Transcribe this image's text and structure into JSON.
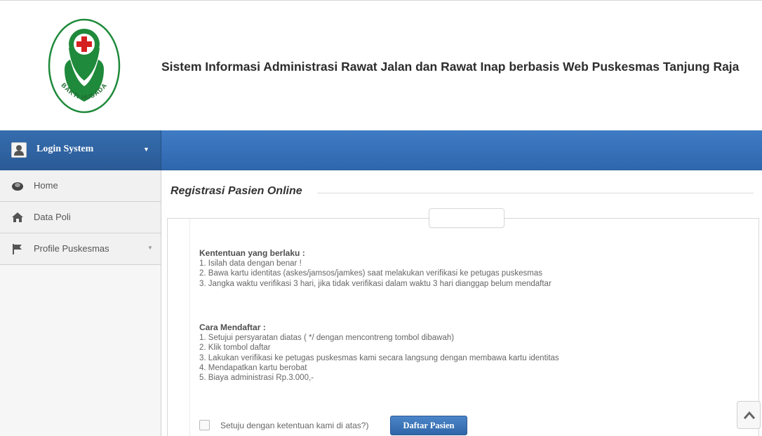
{
  "header": {
    "logo_text": "BAKTI HUSADA",
    "title": "Sistem Informasi Administrasi Rawat Jalan dan Rawat Inap berbasis Web Puskesmas Tanjung Raja"
  },
  "topbar": {
    "login_label": "Login System",
    "login_icon": "user-icon",
    "caret_icon": "caret-down-icon"
  },
  "sidebar": {
    "items": [
      {
        "label": "Home",
        "icon": "home-icon"
      },
      {
        "label": "Data Poli",
        "icon": "house-icon"
      },
      {
        "label": "Profile Puskesmas",
        "icon": "flag-icon",
        "has_submenu": true
      }
    ]
  },
  "main": {
    "title": "Registrasi Pasien Online",
    "rules": {
      "heading": "Kententuan yang berlaku :",
      "items": [
        "1. Isilah data dengan benar !",
        "2. Bawa kartu identitas (askes/jamsos/jamkes) saat melakukan verifikasi ke petugas puskesmas",
        "3. Jangka waktu verifikasi 3 hari, jika tidak verifikasi dalam waktu 3 hari dianggap belum mendaftar"
      ]
    },
    "steps": {
      "heading": "Cara Mendaftar :",
      "items": [
        "1. Setujui persyaratan diatas ( */ dengan mencontreng tombol dibawah)",
        "2. Klik tombol daftar",
        "3. Lakukan verifikasi ke petugas puskesmas kami secara langsung dengan membawa kartu identitas",
        "4. Mendapatkan kartu berobat",
        "5. Biaya administrasi Rp.3.000,-"
      ]
    },
    "agree_label": "Setuju dengan ketentuan kami di atas?)",
    "agree_checked": false,
    "register_button": "Daftar Pasien"
  },
  "colors": {
    "topbar_blue": "#3a74bd",
    "logo_green": "#1f8a3b",
    "button_blue": "#3b74ba"
  }
}
